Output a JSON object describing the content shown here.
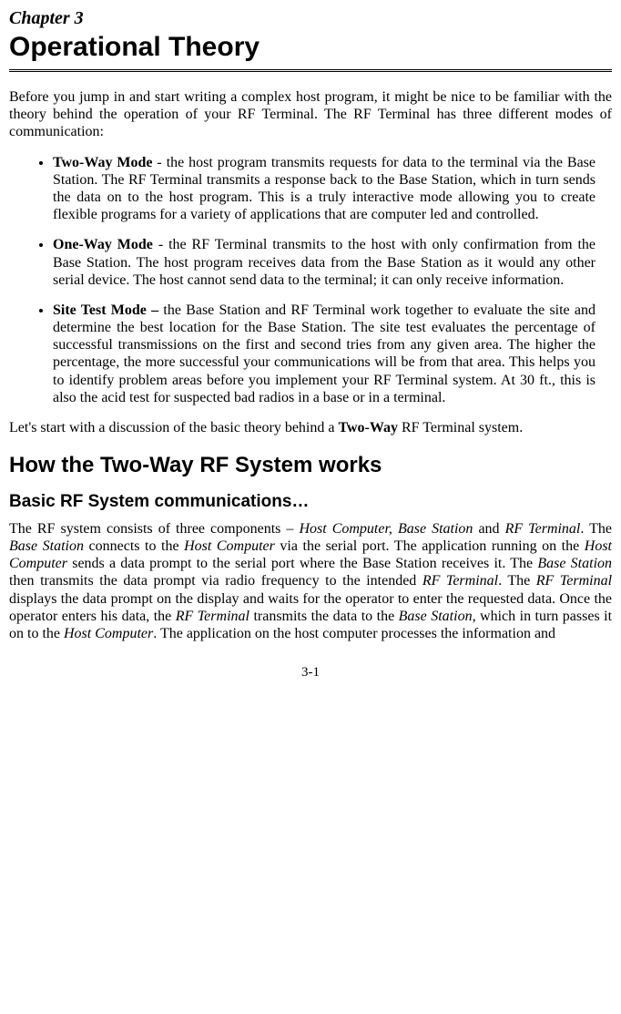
{
  "chapter": {
    "label": "Chapter 3",
    "title": "Operational Theory"
  },
  "intro": "Before you jump in and start writing a complex host program, it might be nice to be familiar with the theory behind the operation of your RF Terminal. The RF Terminal has three different modes of communication:",
  "modes": [
    {
      "name": "Two-Way Mode",
      "sep": "  - ",
      "desc": "the host program transmits requests for data to the terminal via the Base Station. The RF Terminal transmits a response back to the Base Station, which in turn sends the data on to the host program. This is a truly interactive mode allowing you to create flexible programs for a variety of applications that are computer led and controlled."
    },
    {
      "name": "One-Way Mode",
      "sep": " - ",
      "desc": "the RF Terminal transmits to the host with only confirmation from the Base Station. The host program receives data from the Base Station as it would any other serial device. The host cannot send data to the terminal; it can only receive information."
    },
    {
      "name": "Site Test Mode –",
      "sep": " ",
      "desc": "the Base Station and RF Terminal work together to evaluate the site and determine the best location for the Base Station. The site test evaluates the percentage of successful transmissions on the first and second tries from any given area. The higher the percentage, the more successful your communications will be from that area. This helps you to identify problem areas before you implement your RF Terminal system. At 30 ft., this is also the acid test for suspected bad radios in a base or in a terminal."
    }
  ],
  "transition": {
    "prefix": "Let's start with a discussion of the basic theory behind a ",
    "bold": "Two-Way",
    "suffix": " RF Terminal system."
  },
  "h2": "How the Two-Way RF System works",
  "h3": "Basic RF System communications…",
  "body": {
    "t1": "The RF system consists of three components – ",
    "i1": "Host Computer, Base Station",
    "t2": " and ",
    "i2": "RF Terminal",
    "t3": ".  The ",
    "i3": "Base Station",
    "t4": " connects to the ",
    "i4": "Host Computer",
    "t5": " via the serial port.  The application running on the ",
    "i5": "Host Computer",
    "t6": " sends a data prompt to the serial port where the Base Station receives it. The ",
    "i6": "Base Station",
    "t7": " then transmits the data prompt via radio frequency to the intended ",
    "i7": "RF Terminal",
    "t8": ".  The ",
    "i8": "RF Terminal",
    "t9": " displays the data prompt on the display and waits for the operator to enter the requested data. Once the operator enters his data, the ",
    "i9": "RF Terminal",
    "t10": " transmits the data to the ",
    "i10": "Base Station,",
    "t11": " which in turn passes it on to the ",
    "i11": "Host Computer",
    "t12": ".  The application on the host computer processes the information and"
  },
  "page_number": "3-1"
}
